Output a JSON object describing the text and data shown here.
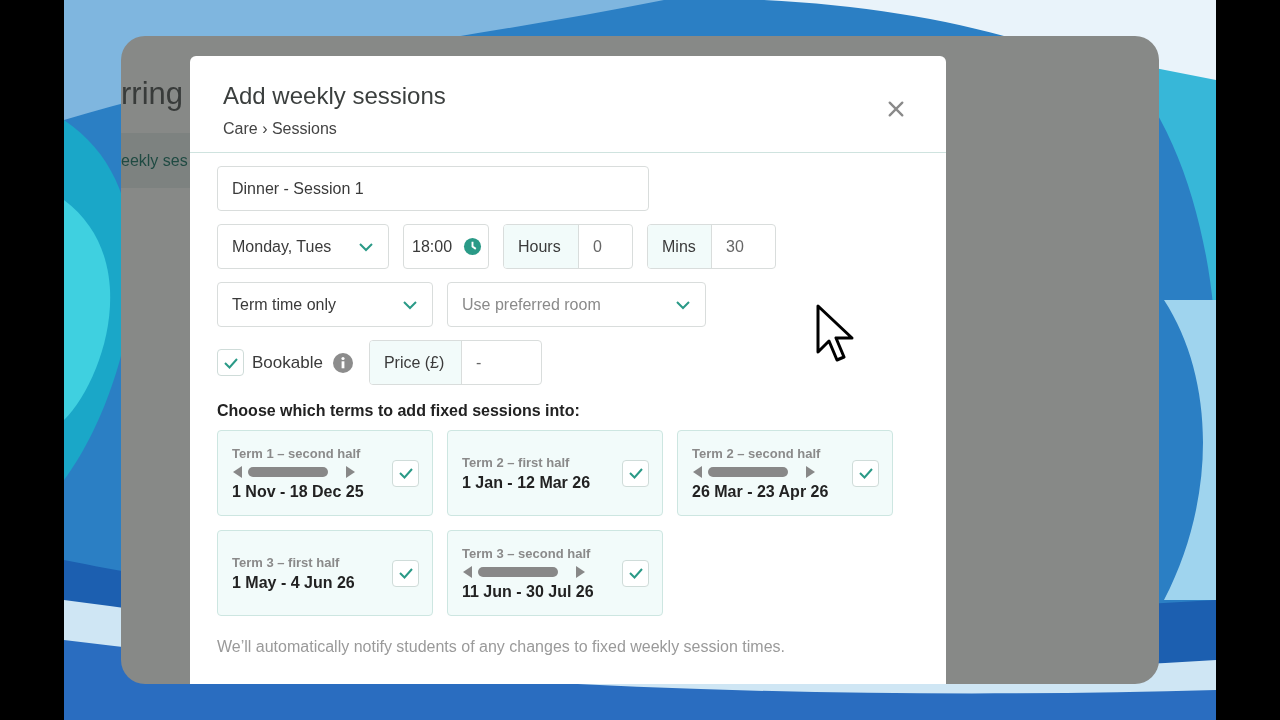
{
  "background_page": {
    "heading": "rring",
    "tab": "eekly ses"
  },
  "dialog": {
    "title": "Add weekly sessions",
    "breadcrumb": "Care › Sessions"
  },
  "name_field": {
    "value": "Dinner - Session 1"
  },
  "days_select": {
    "value": "Monday, Tues"
  },
  "time_field": {
    "value": "18:00"
  },
  "hours": {
    "label": "Hours",
    "value": "0"
  },
  "mins": {
    "label": "Mins",
    "value": "30"
  },
  "term_select": {
    "value": "Term time only"
  },
  "room_select": {
    "placeholder": "Use preferred room"
  },
  "bookable": {
    "label": "Bookable",
    "checked": true
  },
  "price": {
    "label": "Price (£)",
    "value": "-"
  },
  "terms_heading": "Choose which terms to add fixed sessions into:",
  "terms": [
    {
      "name": "Term 1 – second half",
      "dates": "1 Nov - 18 Dec 25",
      "checked": true,
      "overflow": true
    },
    {
      "name": "Term 2 – first half",
      "dates": "1 Jan - 12 Mar 26",
      "checked": true,
      "overflow": false
    },
    {
      "name": "Term 2 – second half",
      "dates": "26 Mar - 23 Apr 26",
      "checked": true,
      "overflow": true
    },
    {
      "name": "Term 3 – first half",
      "dates": "1 May - 4 Jun 26",
      "checked": true,
      "overflow": false
    },
    {
      "name": "Term 3 – second half",
      "dates": "11 Jun - 30 Jul 26",
      "checked": true,
      "overflow": true
    }
  ],
  "footer_note": "We’ll automatically notify students of any changes to fixed weekly session times."
}
